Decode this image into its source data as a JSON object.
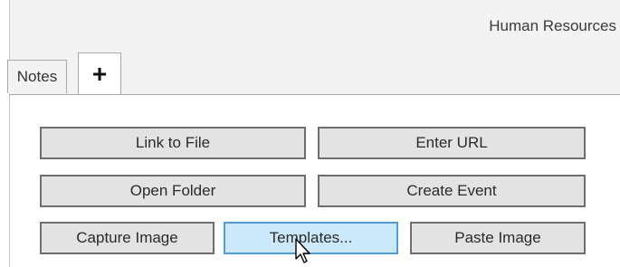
{
  "header": {
    "section_title": "Human Resources"
  },
  "tabs": [
    {
      "label": "Notes"
    },
    {
      "label": "+"
    }
  ],
  "buttons": {
    "link_to_file": "Link to File",
    "enter_url": "Enter URL",
    "open_folder": "Open Folder",
    "create_event": "Create Event",
    "capture_image": "Capture Image",
    "templates": "Templates...",
    "paste_image": "Paste Image"
  },
  "colors": {
    "button_bg": "#e3e3e3",
    "button_hover_bg": "#cce8fb",
    "button_hover_border": "#4f9cd8"
  },
  "icons": {
    "cursor": "mouse-pointer-icon",
    "add_tab": "plus-icon"
  }
}
